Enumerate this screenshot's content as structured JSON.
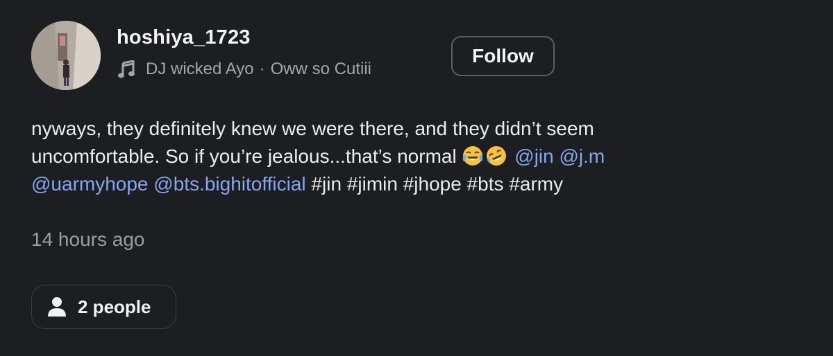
{
  "post": {
    "author": {
      "username": "hoshiya_1723",
      "music_icon": "music-note-icon",
      "music_artist": "DJ wicked Ayo",
      "music_separator": "·",
      "music_track": "Oww so Cutiii"
    },
    "follow_label": "Follow",
    "body": {
      "line1": "nyways, they definitely knew we were there, and they didn’t seem",
      "line2_text": "uncomfortable. So if you’re jealous...that’s normal",
      "emoji_1": "face-with-tears-of-joy-emoji",
      "emoji_2": "rolling-on-floor-laughing-emoji",
      "mentions": [
        "@jin",
        "@j.m",
        "@uarmyhope",
        "@bts.bighitofficial"
      ],
      "hashtags": [
        "#jin",
        "#jimin",
        "#jhope",
        "#bts",
        "#army"
      ]
    },
    "timestamp": "14 hours ago",
    "people_button": {
      "icon": "person-icon",
      "label": "2 people"
    }
  },
  "colors": {
    "background": "#1d1e22",
    "mention": "#86a6ee",
    "secondary_text": "#a3a6ad",
    "primary_text": "#f2f3f5"
  }
}
